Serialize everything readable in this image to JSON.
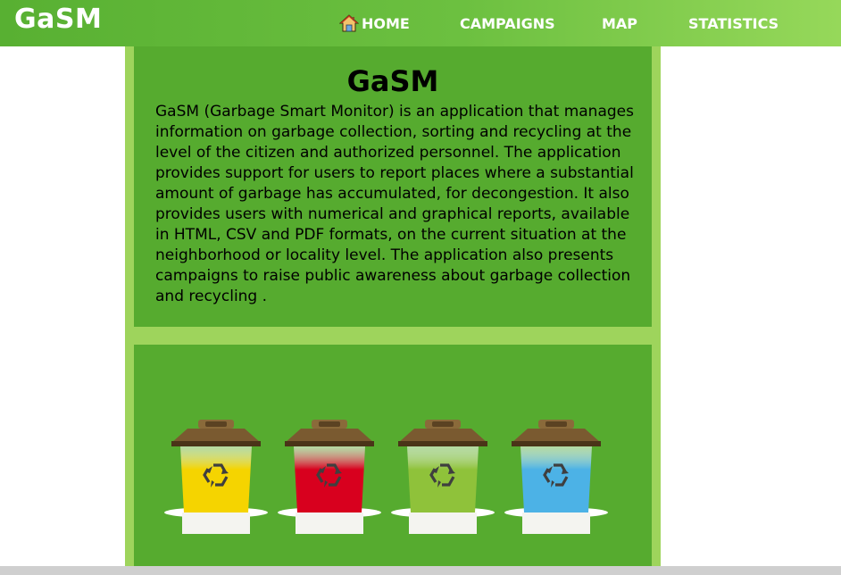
{
  "app": {
    "logo": "GaSM"
  },
  "nav": {
    "items": [
      {
        "label": "HOME",
        "icon": "home-icon"
      },
      {
        "label": "CAMPAIGNS"
      },
      {
        "label": "MAP"
      },
      {
        "label": "STATISTICS"
      }
    ]
  },
  "about": {
    "title": "GaSM",
    "text": "GaSM (Garbage Smart Monitor) is an application that manages information on garbage collection, sorting and recycling at the level of the citizen and authorized personnel. The application provides support for users to report places where a substantial amount of garbage has accumulated, for decongestion. It also provides users with numerical and graphical reports, available in HTML, CSV and PDF formats, on the current situation at the neighborhood or locality level. The application also presents campaigns to raise public awareness about garbage collection and recycling ."
  },
  "bins": [
    {
      "color": "#f5d400",
      "icon": "recycle-icon"
    },
    {
      "color": "#d8001e",
      "icon": "recycle-icon"
    },
    {
      "color": "#8fc23a",
      "icon": "recycle-icon"
    },
    {
      "color": "#4cb2e6",
      "icon": "recycle-icon"
    }
  ],
  "colors": {
    "nav": "#58b032",
    "panel": "#56ab2f",
    "container": "#9ed45c"
  }
}
